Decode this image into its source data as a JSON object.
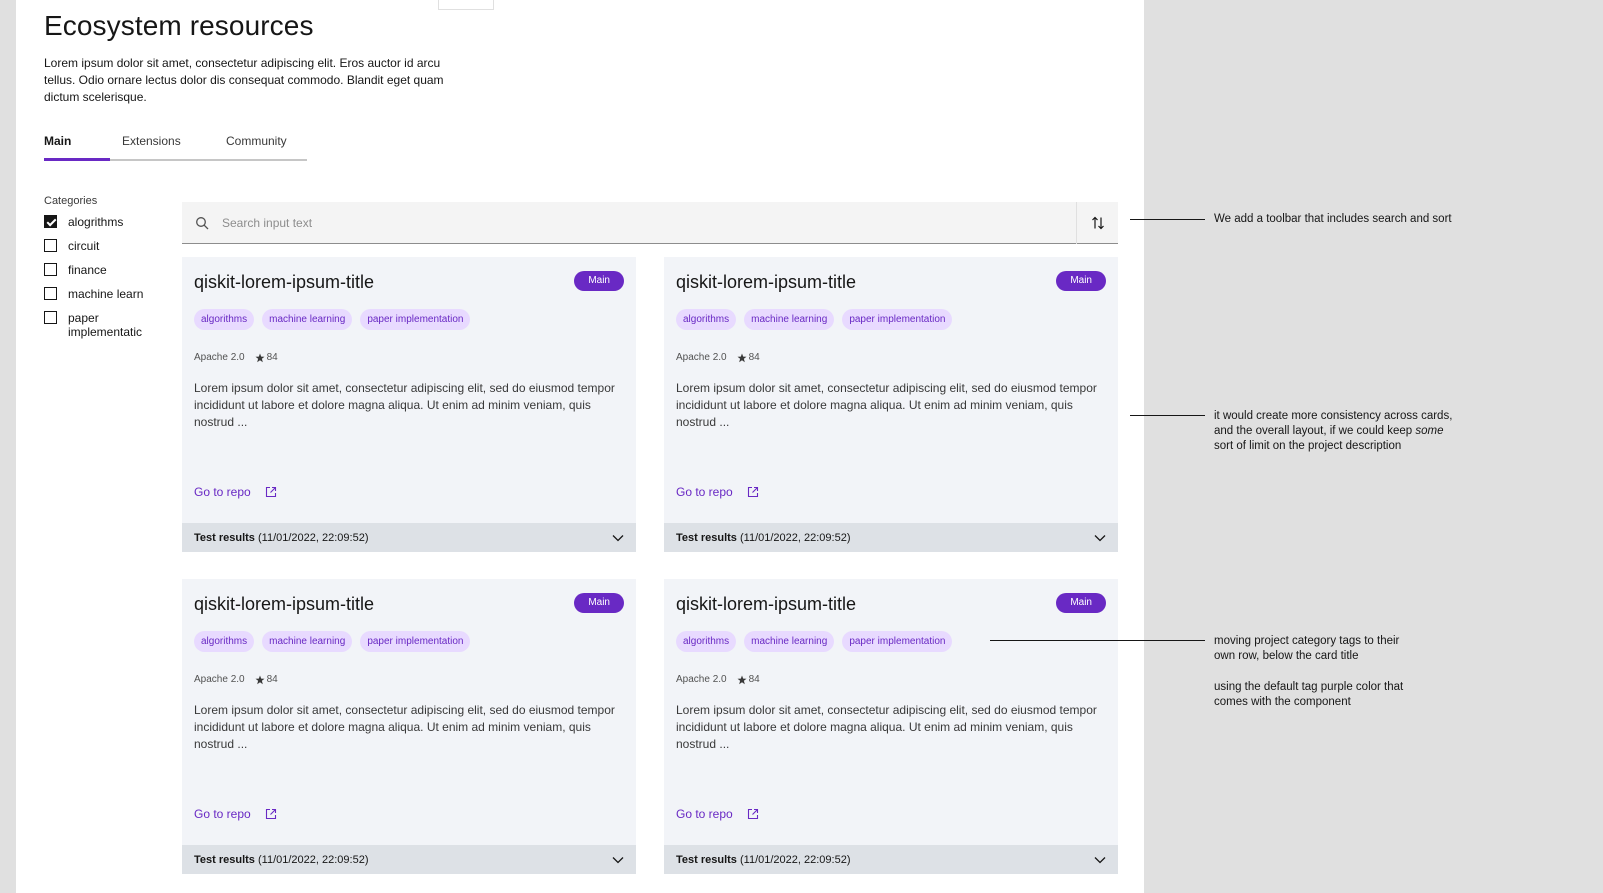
{
  "page": {
    "title": "Ecosystem resources",
    "description": "Lorem ipsum dolor sit amet, consectetur adipiscing elit. Eros auctor id arcu tellus. Odio ornare lectus dolor dis consequat commodo. Blandit eget quam dictum scelerisque."
  },
  "tabs": [
    {
      "label": "Main",
      "selected": true
    },
    {
      "label": "Extensions",
      "selected": false
    },
    {
      "label": "Community",
      "selected": false
    }
  ],
  "categories": {
    "title": "Categories",
    "items": [
      {
        "label": "alogrithms",
        "checked": true
      },
      {
        "label": "circuit",
        "checked": false
      },
      {
        "label": "finance",
        "checked": false
      },
      {
        "label": "machine learn",
        "checked": false
      },
      {
        "label": "paper implementatic",
        "checked": false
      }
    ]
  },
  "toolbar": {
    "search_placeholder": "Search input text",
    "search_icon": "search-icon",
    "sort_icon": "sort-icon"
  },
  "card": {
    "title": "qiskit-lorem-ipsum-title",
    "badge": "Main",
    "tags": [
      "algorithms",
      "machine learning",
      "paper implementation"
    ],
    "license": "Apache 2.0",
    "stars": "84",
    "body": "Lorem ipsum dolor sit amet, consectetur adipiscing elit, sed do eiusmod tempor incididunt ut labore et dolore magna aliqua. Ut enim ad minim veniam, quis nostrud ...",
    "repo_link": "Go to repo",
    "results_label": "Test results",
    "results_time": "(11/01/2022, 22:09:52)"
  },
  "notes": {
    "toolbar": "We add a toolbar that includes search and sort",
    "consistency": "it would create more consistency across cards, and the overall layout, if we could keep some sort of limit on the project description",
    "consistency_1": "it would create more consistency across cards,",
    "consistency_2": "and the overall layout, if we could keep",
    "consistency_em": "some",
    "consistency_3": "sort of limit on the project description",
    "tags_1": "moving project category tags to their",
    "tags_2": "own row, below the card title",
    "tags_3": "using the default tag purple color that",
    "tags_4": "comes with the component"
  },
  "colors": {
    "accent": "#6929c4",
    "tag_bg": "#e8daff",
    "card_bg": "#f2f4f8",
    "results_bg": "#dde1e6"
  }
}
